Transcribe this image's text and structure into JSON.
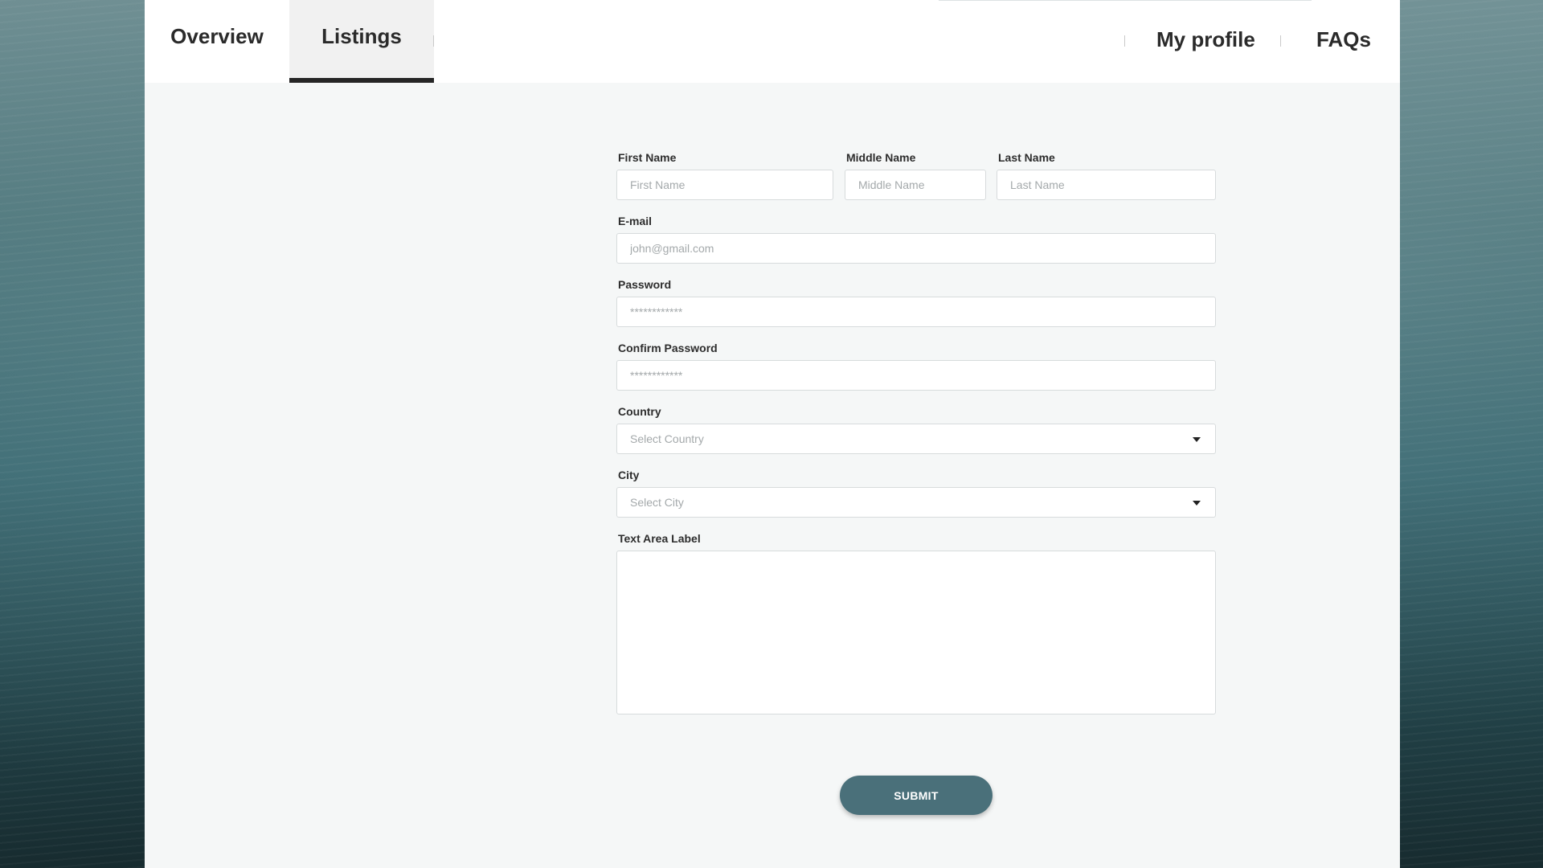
{
  "nav": {
    "tabs": [
      {
        "label": "Overview",
        "active": false
      },
      {
        "label": "Listings",
        "active": true
      }
    ],
    "right_links": [
      "My profile",
      "FAQs"
    ]
  },
  "form": {
    "first_name": {
      "label": "First Name",
      "placeholder": "First Name",
      "value": ""
    },
    "middle_name": {
      "label": "Middle Name",
      "placeholder": "Middle Name",
      "value": ""
    },
    "last_name": {
      "label": "Last Name",
      "placeholder": "Last Name",
      "value": ""
    },
    "email": {
      "label": "E-mail",
      "placeholder": "john@gmail.com",
      "value": ""
    },
    "password": {
      "label": "Password",
      "placeholder": "************",
      "value": ""
    },
    "confirm_password": {
      "label": "Confirm Password",
      "placeholder": "************",
      "value": ""
    },
    "country": {
      "label": "Country",
      "selected": "Select Country"
    },
    "city": {
      "label": "City",
      "selected": "Select City"
    },
    "textarea": {
      "label": "Text Area Label",
      "value": ""
    },
    "submit_label": "SUBMIT"
  },
  "colors": {
    "accent": "#4a707a",
    "active_tab_underline": "#262626"
  }
}
